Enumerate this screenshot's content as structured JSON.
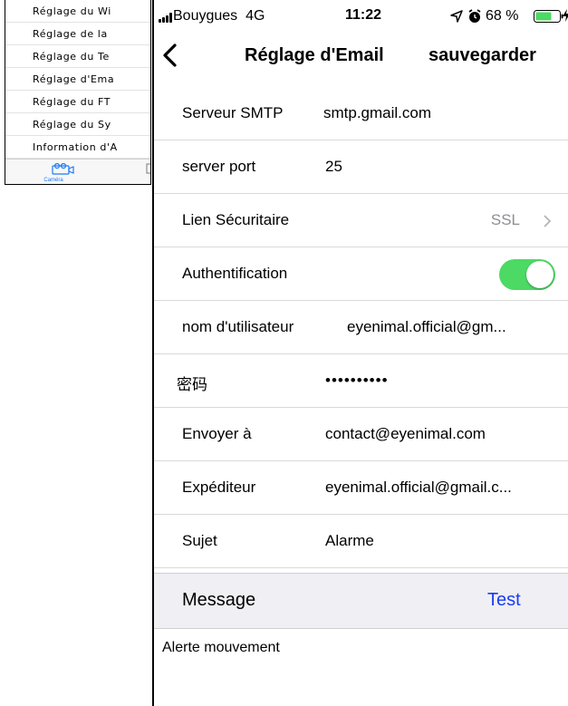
{
  "background_screen": {
    "items": [
      "Réglage du Wi",
      "Réglage de la",
      "Réglage du Te",
      "Réglage d'Ema",
      "Réglage du FT",
      "Réglage du Sy",
      "Information d'A"
    ],
    "tab_camera_label": "Caméra",
    "tab_camera_icon": "camera-icon",
    "tab_second_icon": "photo-icon",
    "accent_color": "#1a7cf5"
  },
  "status_bar": {
    "carrier": "Bouygues",
    "network": "4G",
    "time": "11:22",
    "battery_percent": "68 %",
    "battery_level": 0.68,
    "icons": [
      "signal-icon",
      "location-icon",
      "alarm-icon",
      "battery-icon",
      "charging-icon"
    ]
  },
  "nav": {
    "back_icon": "chevron-left-icon",
    "title": "Réglage d'Email",
    "save_label": "sauvegarder"
  },
  "settings": {
    "smtp_label": "Serveur SMTP",
    "smtp_value": "smtp.gmail.com",
    "port_label": "server port",
    "port_value": "25",
    "security_label": "Lien Sécuritaire",
    "security_value": "SSL",
    "auth_label": "Authentification",
    "auth_enabled": true,
    "auth_color": "#4cd964",
    "username_label": "nom d'utilisateur",
    "username_value": "eyenimal.official@gm...",
    "password_label": "密码",
    "password_value": "••••••••••",
    "send_to_label": "Envoyer à",
    "send_to_value": "contact@eyenimal.com",
    "sender_label": "Expéditeur",
    "sender_value": "eyenimal.official@gmail.c...",
    "subject_label": "Sujet",
    "subject_value": "Alarme"
  },
  "message": {
    "label": "Message",
    "test_label": "Test",
    "test_color": "#1a3cf2",
    "body": "Alerte mouvement"
  }
}
